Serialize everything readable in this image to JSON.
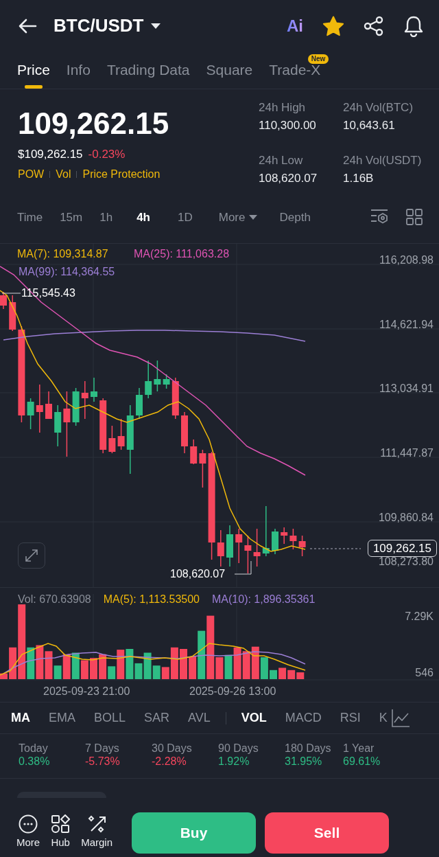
{
  "header": {
    "title": "BTC/USDT",
    "ai_label": "Ai",
    "favorite": true
  },
  "tabs": [
    {
      "label": "Price",
      "selected": true
    },
    {
      "label": "Info",
      "selected": false
    },
    {
      "label": "Trading Data",
      "selected": false
    },
    {
      "label": "Square",
      "selected": false
    },
    {
      "label": "Trade-X",
      "selected": false,
      "badge": "New"
    }
  ],
  "price": {
    "last": "109,262.15",
    "fiat": "$109,262.15",
    "change": "-0.23%",
    "color": "#f6465d",
    "tags": [
      "POW",
      "Vol",
      "Price Protection"
    ]
  },
  "stats": [
    {
      "label": "24h High",
      "value": "110,300.00"
    },
    {
      "label": "24h Vol(BTC)",
      "value": "10,643.61"
    },
    {
      "label": "24h Low",
      "value": "108,620.07"
    },
    {
      "label": "24h Vol(USDT)",
      "value": "1.16B"
    }
  ],
  "intervals": [
    {
      "label": "Time",
      "selected": false,
      "kind": "option"
    },
    {
      "label": "15m",
      "selected": false,
      "kind": "option"
    },
    {
      "label": "1h",
      "selected": false,
      "kind": "option"
    },
    {
      "label": "4h",
      "selected": true,
      "kind": "option"
    },
    {
      "label": "1D",
      "selected": false,
      "kind": "option"
    },
    {
      "label": "More",
      "selected": false,
      "kind": "dropdown"
    },
    {
      "label": "Depth",
      "selected": false,
      "kind": "option"
    }
  ],
  "chart": {
    "legend": [
      {
        "text": "MA(7): 109,314.87",
        "color": "#f0b90b"
      },
      {
        "text": "MA(25): 111,063.28",
        "color": "#e054b4"
      },
      {
        "text": "MA(99): 114,364.55",
        "color": "#9c7fd6"
      }
    ],
    "y_labels": [
      "116,208.98",
      "114,621.94",
      "113,034.91",
      "111,447.87",
      "109,860.84",
      "108,273.80"
    ],
    "high_label": "115,545.43",
    "low_label": "108,620.07",
    "last_price": "109,262.15"
  },
  "volume": {
    "legend": [
      {
        "text": "Vol: 670.63908",
        "color": "#8a8f99"
      },
      {
        "text": "MA(5): 1,113.53500",
        "color": "#f0b90b"
      },
      {
        "text": "MA(10): 1,896.35361",
        "color": "#9c7fd6"
      }
    ],
    "y_labels": [
      "7.29K",
      "546"
    ],
    "x_labels": [
      "2025-09-23 21:00",
      "2025-09-26 13:00"
    ]
  },
  "indicators": [
    {
      "label": "MA",
      "selected": true
    },
    {
      "label": "EMA",
      "selected": false
    },
    {
      "label": "BOLL",
      "selected": false
    },
    {
      "label": "SAR",
      "selected": false
    },
    {
      "label": "AVL",
      "selected": false
    },
    {
      "label": "VOL",
      "selected": true
    },
    {
      "label": "MACD",
      "selected": false
    },
    {
      "label": "RSI",
      "selected": false
    },
    {
      "label": "K",
      "selected": false
    }
  ],
  "periods": [
    {
      "label": "Today",
      "value": "0.38%",
      "color": "#2ebd85"
    },
    {
      "label": "7 Days",
      "value": "-5.73%",
      "color": "#f6465d"
    },
    {
      "label": "30 Days",
      "value": "-2.28%",
      "color": "#f6465d"
    },
    {
      "label": "90 Days",
      "value": "1.92%",
      "color": "#2ebd85"
    },
    {
      "label": "180 Days",
      "value": "31.95%",
      "color": "#2ebd85"
    },
    {
      "label": "1 Year",
      "value": "69.61%",
      "color": "#2ebd85"
    }
  ],
  "bottom": {
    "actions": [
      {
        "label": "More",
        "kind": "more"
      },
      {
        "label": "Hub",
        "kind": "hub"
      },
      {
        "label": "Margin",
        "kind": "margin"
      }
    ],
    "buy": "Buy",
    "sell": "Sell"
  }
}
